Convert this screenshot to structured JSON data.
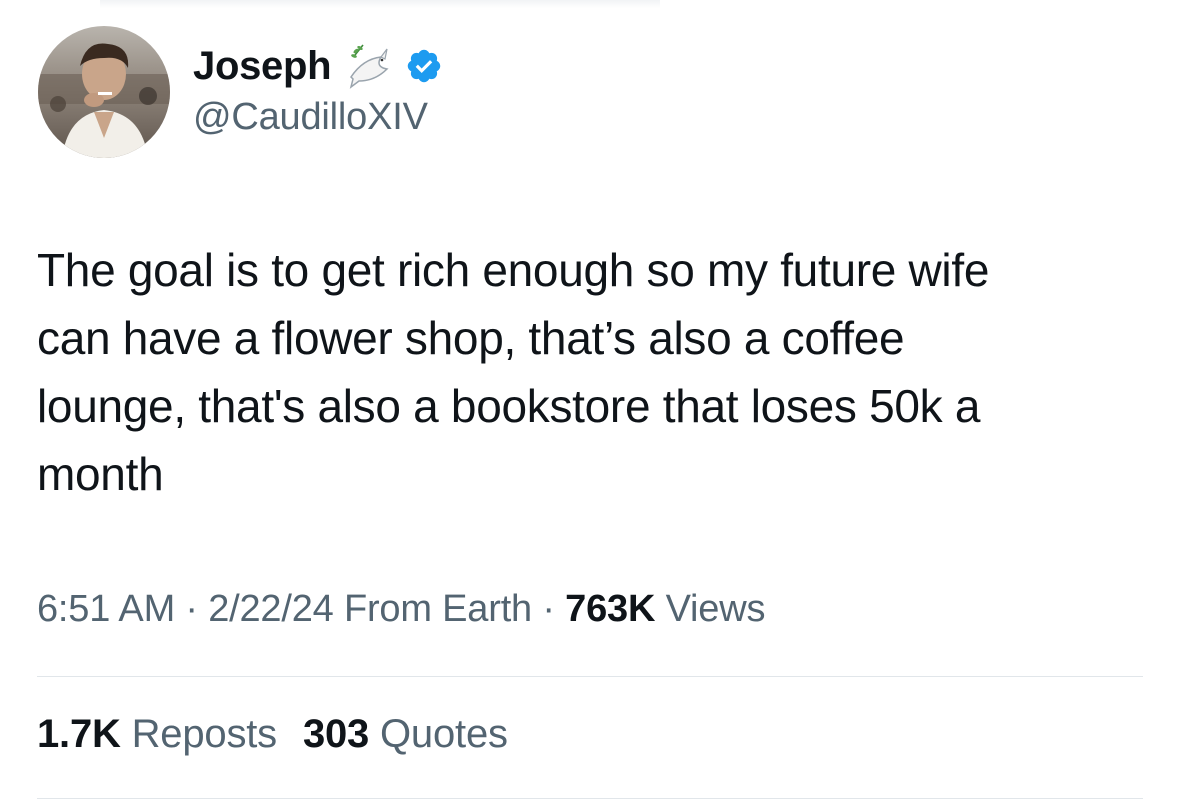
{
  "author": {
    "display_name": "Joseph",
    "handle": "@CaudilloXIV",
    "emoji_icon": "dove-with-olive-branch-icon",
    "verified_icon": "verified-badge-icon",
    "verified_color": "#1d9bf0"
  },
  "tweet": {
    "lines": [
      "The goal is to get rich enough so my future wife",
      "can have a flower shop, that’s also a coffee",
      "lounge, that's also a bookstore that loses 50k a",
      "month"
    ]
  },
  "meta": {
    "time": "6:51 AM",
    "sep1": " · ",
    "date": "2/22/24",
    "source": " From Earth",
    "sep2": " · ",
    "views_count": "763K",
    "views_label": " Views"
  },
  "stats": {
    "reposts_count": "1.7K",
    "reposts_label": " Reposts",
    "quotes_count": "303",
    "quotes_label": " Quotes"
  },
  "colors": {
    "text": "#0f1419",
    "secondary": "#536471",
    "divider": "#e1e6ea"
  }
}
